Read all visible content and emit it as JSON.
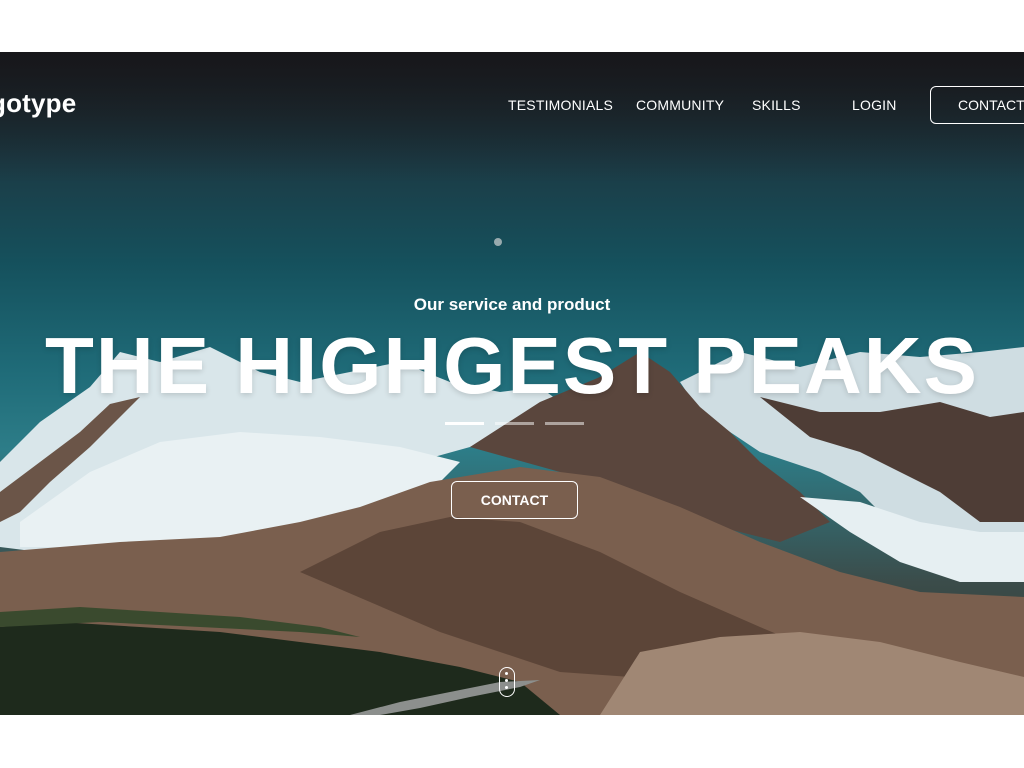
{
  "header": {
    "logo_text": "gotype",
    "nav": {
      "testimonials": "TESTIMONIALS",
      "community": "COMMUNITY",
      "skills": "SKILLS",
      "login": "LOGIN",
      "contact": "CONTACT"
    }
  },
  "hero": {
    "subtitle": "Our service and product",
    "headline": "THE HIGHGEST PEAKS",
    "cta_label": "CONTACT",
    "slider": {
      "count": 3,
      "active_index": 0
    },
    "background_image": "mountain-landscape-icon"
  },
  "colors": {
    "text": "#ffffff",
    "page_background": "#ffffff",
    "sky": "#1f6b78"
  }
}
